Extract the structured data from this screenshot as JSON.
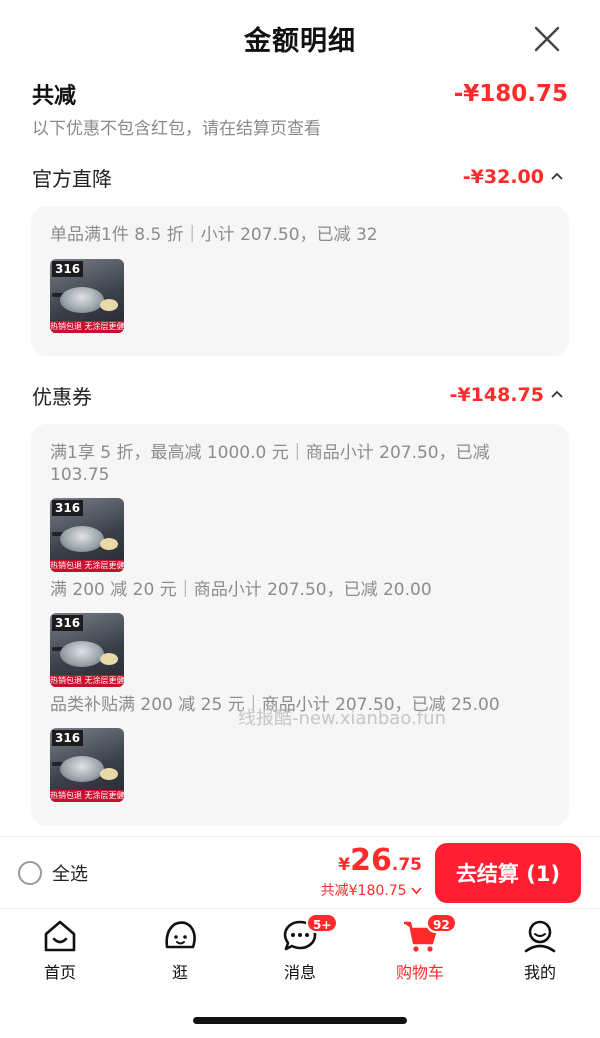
{
  "sheet": {
    "title": "金额明细"
  },
  "summary": {
    "label": "共减",
    "amount": "-¥180.75",
    "note": "以下优惠不包含红包，请在结算页查看"
  },
  "official_discount": {
    "title": "官方直降",
    "amount": "-¥32.00",
    "rules": [
      {
        "text": "单品满1件 8.5 折｜小计 207.50，已减 32"
      }
    ]
  },
  "coupons": {
    "title": "优惠券",
    "amount": "-¥148.75",
    "rules": [
      {
        "text": "满1享 5 折，最高减 1000.0 元｜商品小计 207.50，已减 103.75"
      },
      {
        "text": "满 200 减 20 元｜商品小计 207.50，已减 20.00"
      },
      {
        "text": "品类补贴满 200 减 25 元｜商品小计 207.50，已减 25.00"
      }
    ]
  },
  "product_thumb": {
    "badge": "316",
    "strip": "热销包退 无涂层更健康"
  },
  "watermark": "线报酷-new.xianbao.fun",
  "bottom_bar": {
    "select_all": "全选",
    "currency": "¥",
    "price_int": "26",
    "price_dec": ".75",
    "saved": "共减¥180.75",
    "checkout": "去结算 (1)"
  },
  "tabs": [
    {
      "label": "首页",
      "icon": "home-icon"
    },
    {
      "label": "逛",
      "icon": "browse-icon"
    },
    {
      "label": "消息",
      "icon": "message-icon",
      "badge": "5+"
    },
    {
      "label": "购物车",
      "icon": "cart-icon",
      "badge": "92",
      "active": true
    },
    {
      "label": "我的",
      "icon": "profile-icon"
    }
  ],
  "colors": {
    "accent": "#ff2a2a",
    "checkout": "#ff1e32",
    "muted_text": "#8c8c8c",
    "card_bg": "#f6f6f6"
  }
}
